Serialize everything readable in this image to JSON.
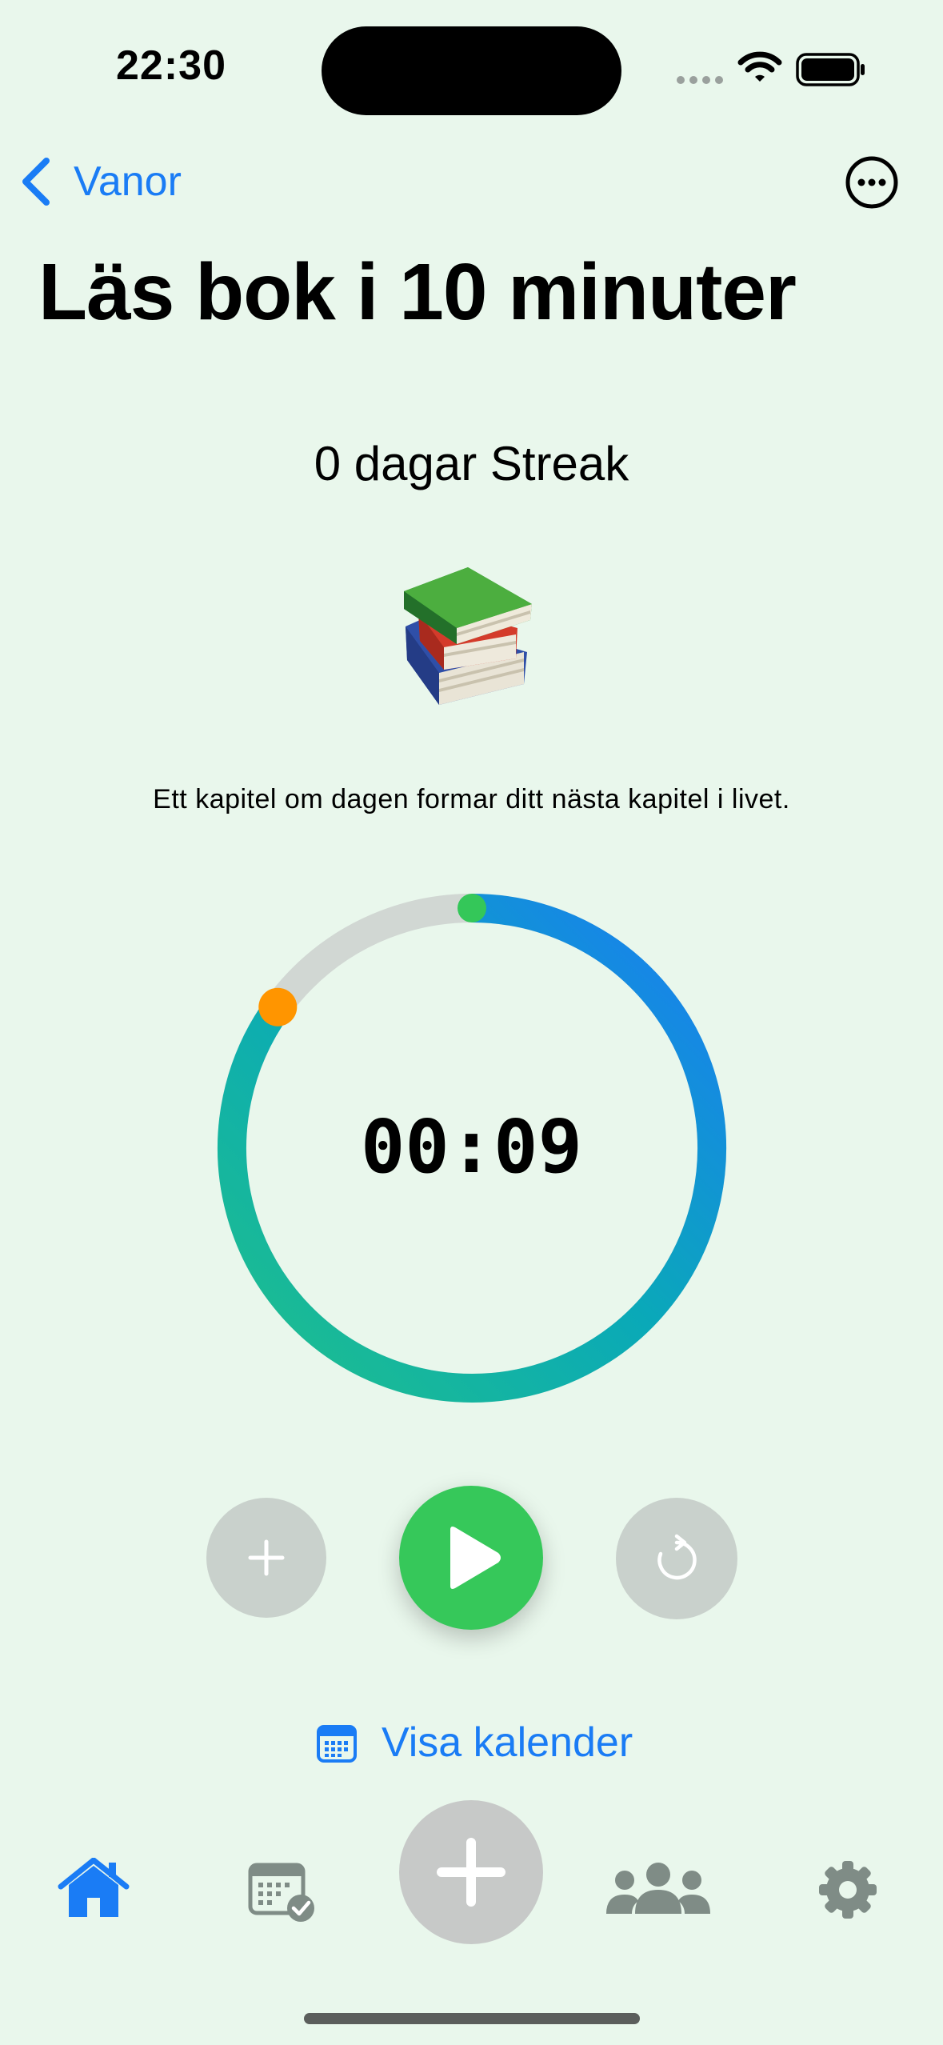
{
  "status_bar": {
    "time": "22:30"
  },
  "nav": {
    "back_label": "Vanor",
    "back_icon": "chevron-left-icon",
    "more_icon": "ellipsis-circle-icon"
  },
  "habit": {
    "title": "Läs bok i 10 minuter",
    "streak_label": "0 dagar Streak",
    "emoji": "books-icon",
    "quote": "Ett kapitel om dagen formar ditt nästa kapitel i livet."
  },
  "timer": {
    "display": "00:09",
    "progress_fraction": 0.85
  },
  "controls": {
    "add_time_icon": "plus-icon",
    "play_icon": "play-icon",
    "reset_icon": "reset-icon"
  },
  "calendar_link": {
    "label": "Visa kalender",
    "icon": "calendar-icon"
  },
  "tab_bar": {
    "items": [
      {
        "icon": "home-icon",
        "active": true
      },
      {
        "icon": "calendar-check-icon",
        "active": false
      },
      {
        "icon": "plus-icon",
        "active": false
      },
      {
        "icon": "people-icon",
        "active": false
      },
      {
        "icon": "gear-icon",
        "active": false
      }
    ]
  },
  "colors": {
    "background": "#e9f7ec",
    "accent_blue": "#1a7cf5",
    "play_green": "#36c85a",
    "ring_track": "#d1d7d3",
    "ring_gradient_start": "#1fc08a",
    "ring_gradient_end": "#1a7cf5",
    "knob_orange": "#ff9500",
    "tab_inactive": "#7f8c86"
  }
}
